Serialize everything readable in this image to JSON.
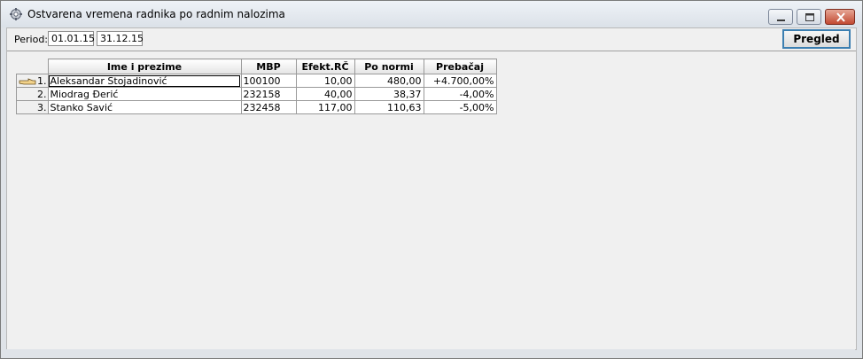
{
  "window": {
    "title": "Ostvarena vremena radnika po radnim nalozima",
    "icon": "gear-icon"
  },
  "toolbar": {
    "period_label": "Period:",
    "date_from": "01.01.15",
    "date_to": "31.12.15",
    "pregled_label": "Pregled"
  },
  "table": {
    "columns": [
      "Ime i prezime",
      "MBP",
      "Efekt.RČ",
      "Po normi",
      "Prebačaj"
    ],
    "rows": [
      {
        "num": "1.",
        "name": "Aleksandar Stojadinović",
        "mbp": "100100",
        "efekt": "10,00",
        "po_normi": "480,00",
        "prebacaj": "+4.700,00%"
      },
      {
        "num": "2.",
        "name": "Miodrag Đerić",
        "mbp": "232158",
        "efekt": "40,00",
        "po_normi": "38,37",
        "prebacaj": "-4,00%"
      },
      {
        "num": "3.",
        "name": "Stanko Savić",
        "mbp": "232458",
        "efekt": "117,00",
        "po_normi": "110,63",
        "prebacaj": "-5,00%"
      }
    ]
  }
}
